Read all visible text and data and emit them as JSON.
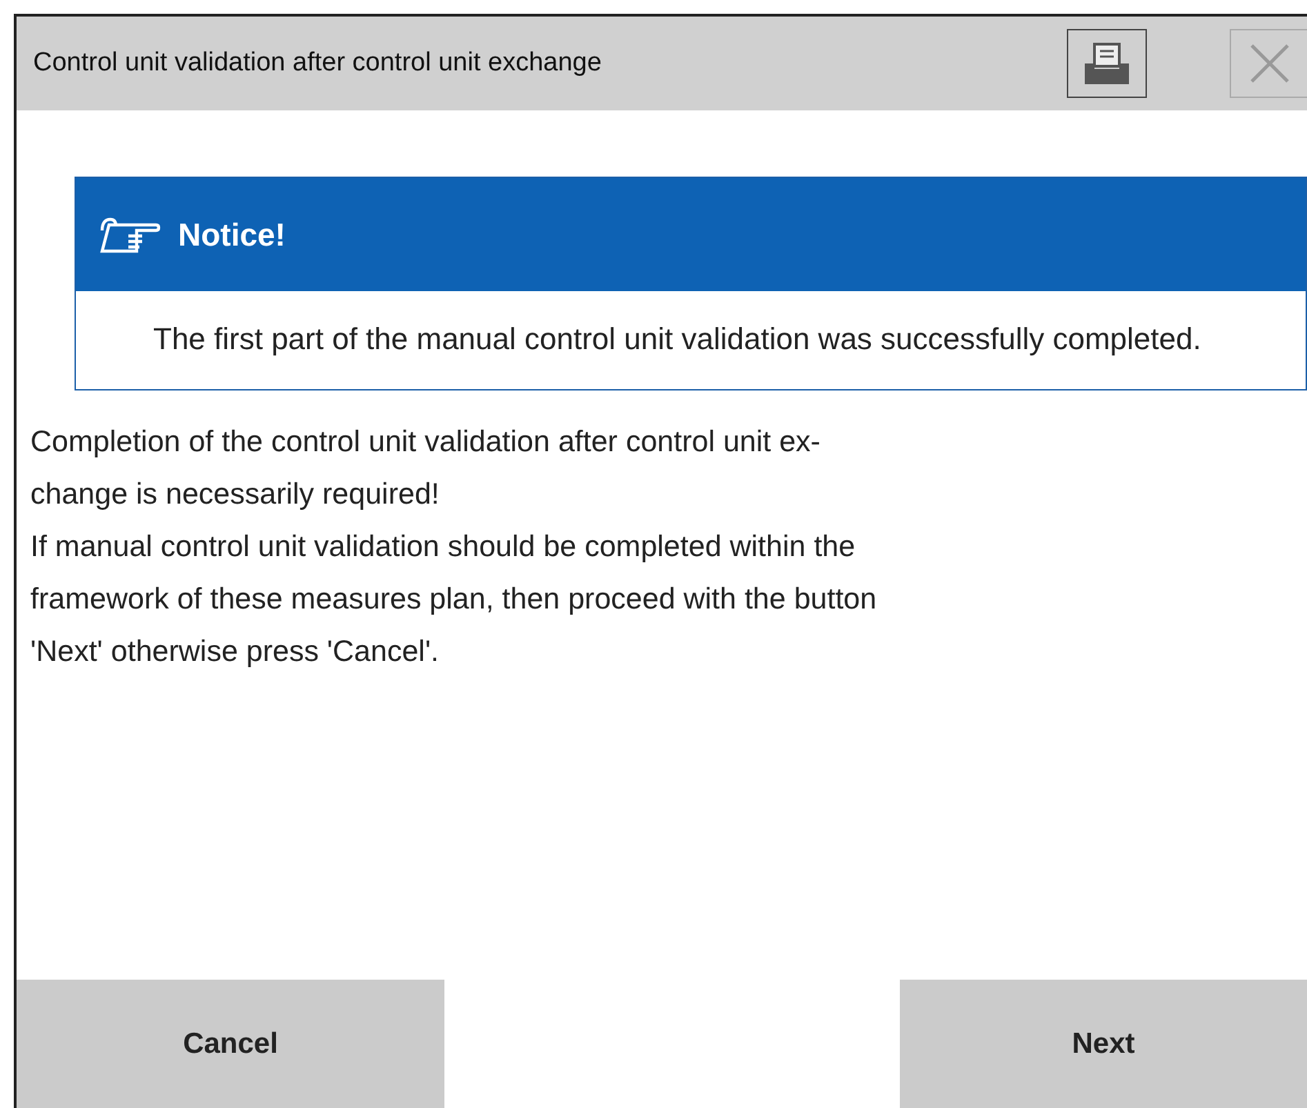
{
  "window": {
    "title": "Control unit validation after control unit exchange",
    "close_disabled": true
  },
  "notice": {
    "title": "Notice!",
    "text": "The first part of the manual control unit validation was successfully completed."
  },
  "body": "Completion of the control unit validation after control unit ex-\nchange is necessarily required!\nIf manual control unit validation should be completed within the\nframework of these measures plan, then proceed with the button\n'Next' otherwise press 'Cancel'.",
  "buttons": [
    {
      "label": "Cancel"
    },
    {
      "label": "Next"
    }
  ]
}
